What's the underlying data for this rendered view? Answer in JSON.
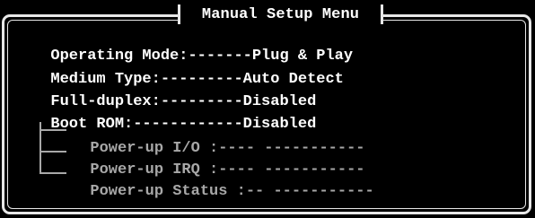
{
  "window": {
    "title": "Manual Setup Menu"
  },
  "colors": {
    "background": "#000000",
    "text": "#ffffff",
    "dim_text": "#a8a8a8",
    "border": "#e8e8e8"
  },
  "settings": [
    {
      "label": "Operating Mode:",
      "leader": "-------",
      "value": "Plug & Play"
    },
    {
      "label": "Medium Type:",
      "leader": "---------",
      "value": "Auto Detect"
    },
    {
      "label": "Full-duplex:",
      "leader": "---------",
      "value": "Disabled"
    },
    {
      "label": "Boot ROM:",
      "leader": "------------",
      "value": "Disabled"
    }
  ],
  "powerup": [
    {
      "label": "Power-up I/O :",
      "leader": "----",
      "value": "-----------"
    },
    {
      "label": "Power-up IRQ :",
      "leader": "----",
      "value": "-----------"
    },
    {
      "label": "Power-up Status :",
      "leader": "--",
      "value": "-----------"
    }
  ]
}
